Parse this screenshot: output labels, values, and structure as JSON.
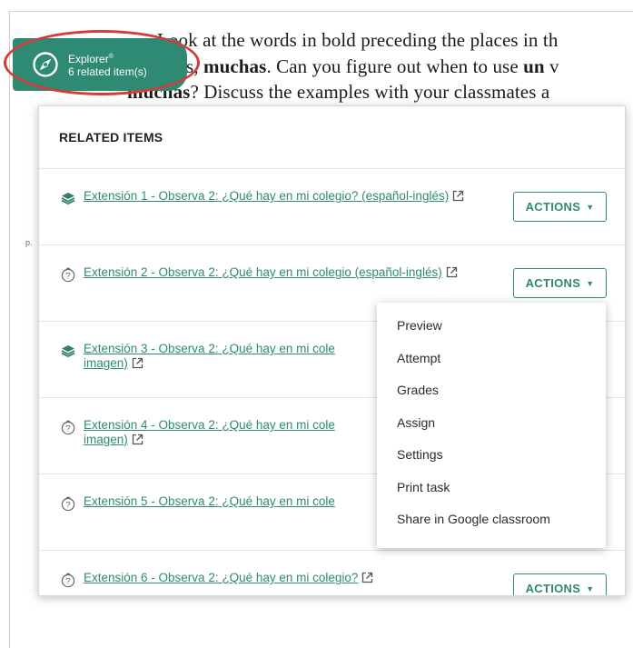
{
  "background": {
    "line1": "Look at the words in bold preceding the places in th",
    "line2_prefix": "s, ",
    "line2_bold1": "muchas",
    "line2_mid": ". Can you figure out when to use ",
    "line2_bold2": "un",
    "line2_suffix": " v",
    "line3_bold": "muchas",
    "line3_rest": "? Discuss the examples with your classmates a",
    "page_marker": "p."
  },
  "explorer": {
    "title": "Explorer",
    "registered": "®",
    "count_text": "6 related item(s)",
    "icon": "compass-icon"
  },
  "panel": {
    "header": "RELATED ITEMS",
    "items": [
      {
        "label": "Extensión 1 - Observa 2: ¿Qué hay en mi colegio? (español-inglés)",
        "icon": "layers-icon",
        "has_actions": true,
        "actions_label": "ACTIONS"
      },
      {
        "label": "Extensión 2 - Observa 2: ¿Qué hay en mi colegio (español-inglés)",
        "icon": "question-timer-icon",
        "has_actions": true,
        "actions_label": "ACTIONS"
      },
      {
        "label": "Extensión 3 - Observa 2: ¿Qué hay en mi cole",
        "label_line2": "imagen)",
        "icon": "layers-icon",
        "has_actions": false
      },
      {
        "label": "Extensión 4 - Observa 2: ¿Qué hay en mi cole",
        "label_line2": "imagen)",
        "icon": "question-timer-icon",
        "has_actions": false
      },
      {
        "label": "Extensión 5 - Observa 2: ¿Qué hay en mi cole",
        "icon": "question-timer-icon",
        "has_actions": false
      },
      {
        "label": "Extensión 6 - Observa 2: ¿Qué hay en mi colegio?",
        "icon": "question-timer-icon",
        "has_actions": true,
        "actions_label": "ACTIONS"
      }
    ]
  },
  "dropdown": {
    "items": [
      "Preview",
      "Attempt",
      "Grades",
      "Assign",
      "Settings",
      "Print task",
      "Share in Google classroom"
    ]
  },
  "colors": {
    "brand_green": "#2e8a73",
    "link_green": "#2f8a72",
    "highlight_ring": "#d63b3b"
  }
}
